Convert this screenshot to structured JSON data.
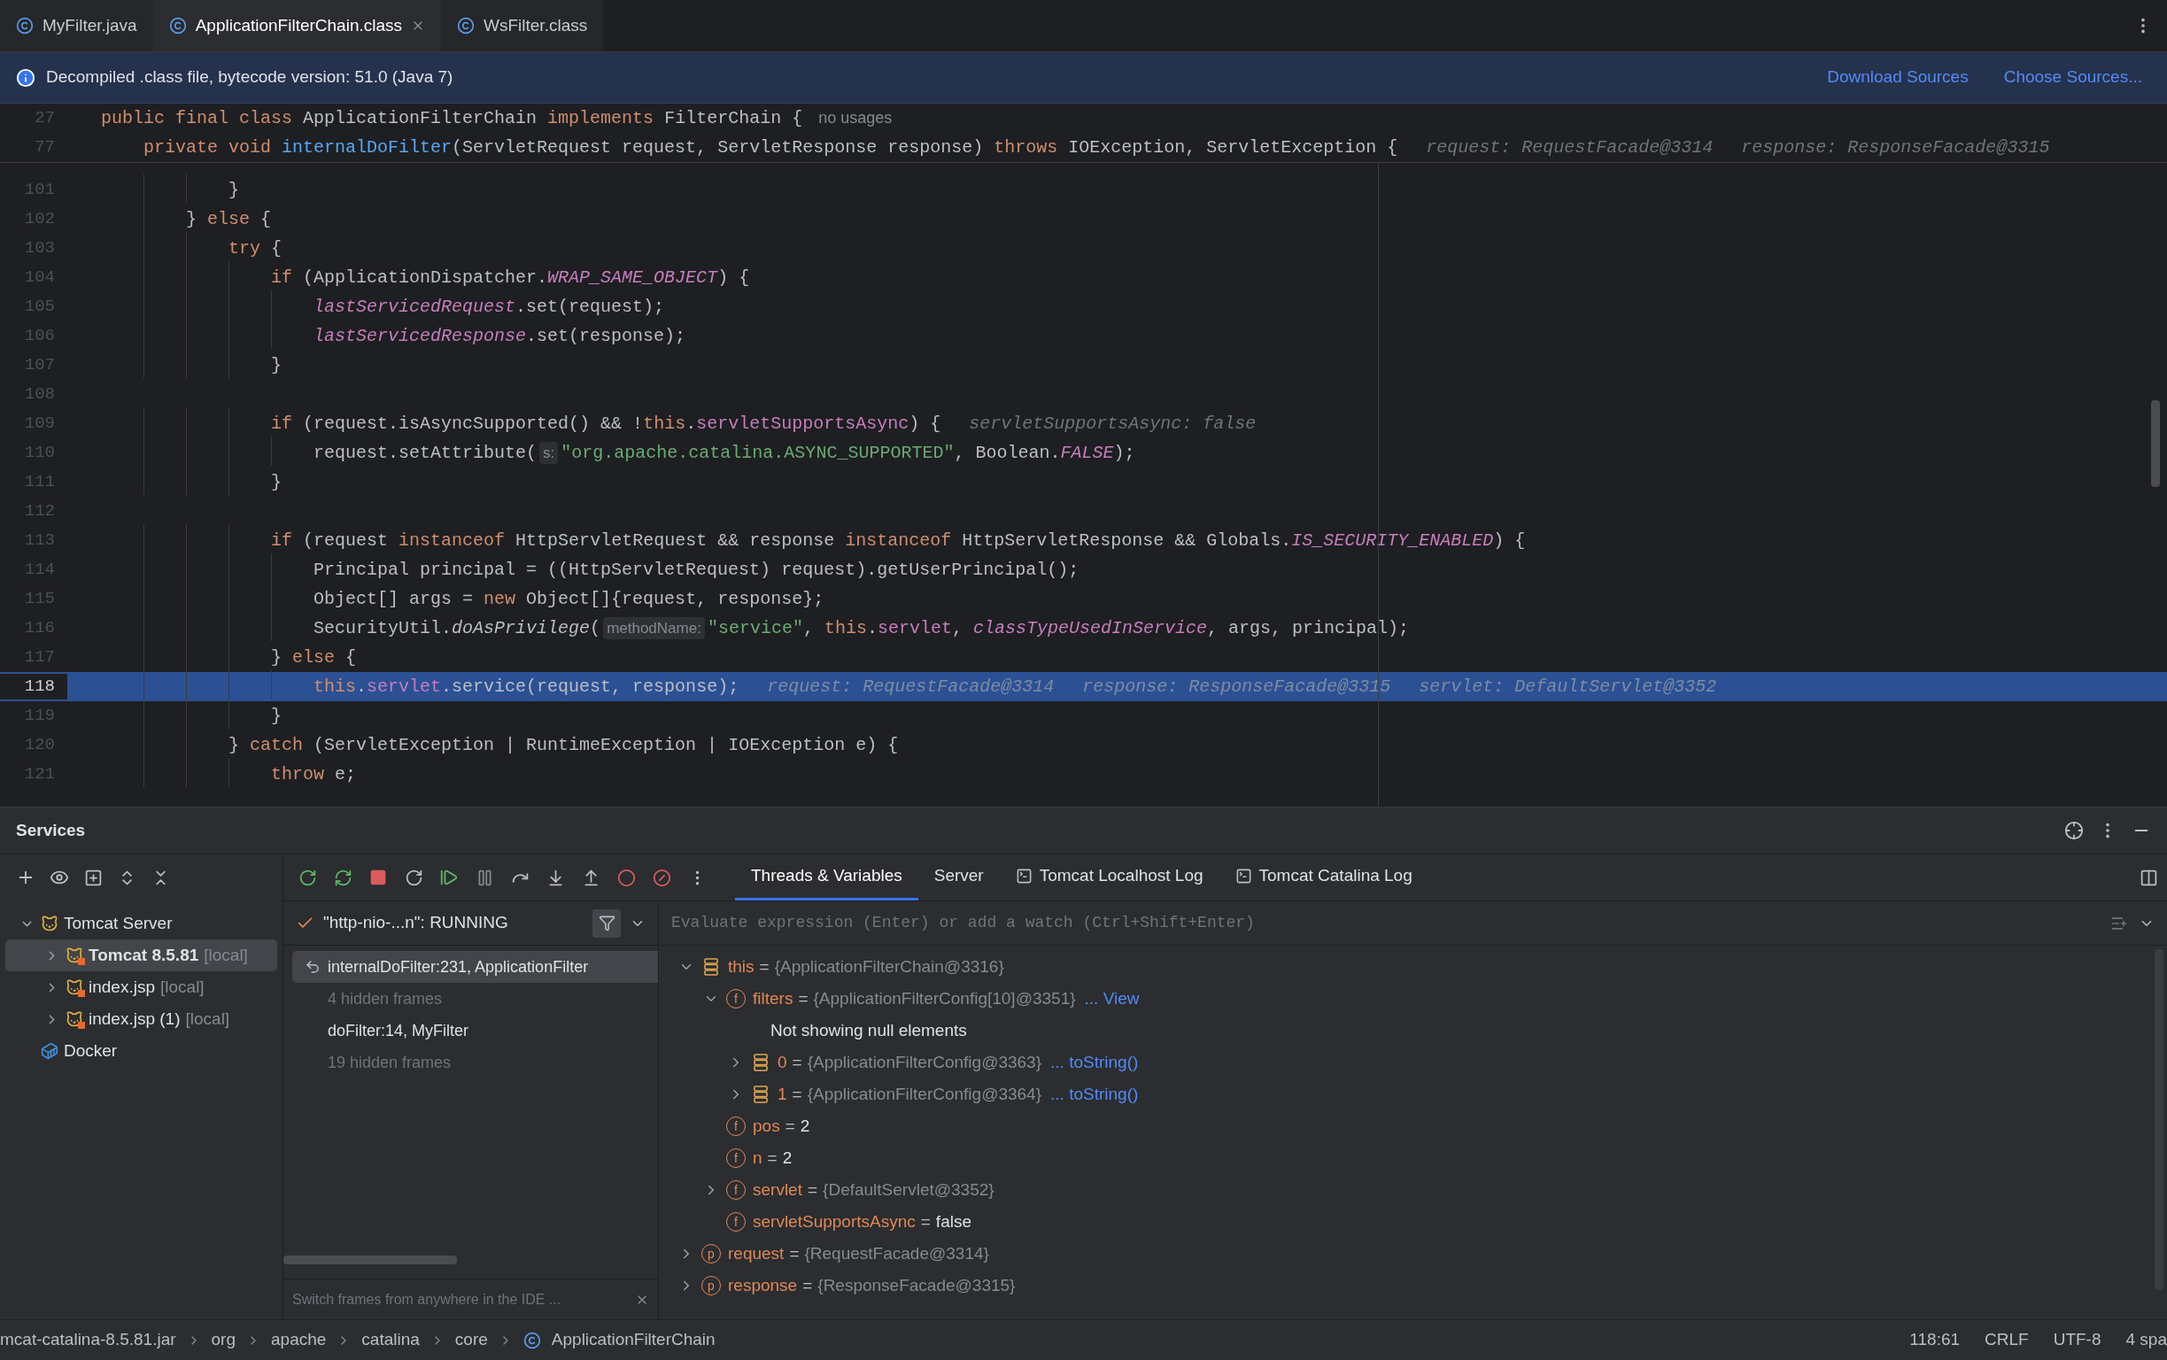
{
  "editor_tabs": [
    {
      "label": "MyFilter.java",
      "selected": false
    },
    {
      "label": "ApplicationFilterChain.class",
      "selected": true
    },
    {
      "label": "WsFilter.class",
      "selected": false
    }
  ],
  "banner": {
    "message": "Decompiled .class file, bytecode version: 51.0 (Java 7)",
    "links": [
      "Download Sources",
      "Choose Sources..."
    ]
  },
  "sticky_lines": [
    {
      "number": "27",
      "tokens": [
        {
          "kind": "keyword",
          "text": "public final class "
        },
        {
          "kind": "plain",
          "text": "ApplicationFilterChain "
        },
        {
          "kind": "keyword",
          "text": "implements "
        },
        {
          "kind": "plain",
          "text": "FilterChain {"
        },
        {
          "kind": "usage",
          "text": "no usages"
        }
      ]
    },
    {
      "number": "77",
      "tokens": [
        {
          "kind": "keyword",
          "text": "    private void "
        },
        {
          "kind": "method",
          "text": "internalDoFilter"
        },
        {
          "kind": "plain",
          "text": "(ServletRequest request, ServletResponse response) "
        },
        {
          "kind": "keyword",
          "text": "throws "
        },
        {
          "kind": "plain",
          "text": "IOException, ServletException {"
        },
        {
          "kind": "value",
          "text": "request: RequestFacade@3314"
        },
        {
          "kind": "value",
          "text": "response: ResponseFacade@3315"
        }
      ]
    }
  ],
  "code_lines": [
    {
      "number": "101",
      "current": false,
      "tokens": [
        {
          "kind": "plain",
          "text": "            }"
        }
      ]
    },
    {
      "number": "102",
      "current": false,
      "tokens": [
        {
          "kind": "plain",
          "text": "        } "
        },
        {
          "kind": "keyword",
          "text": "else"
        },
        {
          "kind": "plain",
          "text": " {"
        }
      ]
    },
    {
      "number": "103",
      "current": false,
      "tokens": [
        {
          "kind": "keyword",
          "text": "            try"
        },
        {
          "kind": "plain",
          "text": " {"
        }
      ]
    },
    {
      "number": "104",
      "current": false,
      "tokens": [
        {
          "kind": "keyword",
          "text": "                if"
        },
        {
          "kind": "plain",
          "text": " (ApplicationDispatcher."
        },
        {
          "kind": "static",
          "text": "WRAP_SAME_OBJECT"
        },
        {
          "kind": "plain",
          "text": ") {"
        }
      ]
    },
    {
      "number": "105",
      "current": false,
      "tokens": [
        {
          "kind": "static",
          "text": "                    lastServicedRequest"
        },
        {
          "kind": "plain",
          "text": ".set(request);"
        }
      ]
    },
    {
      "number": "106",
      "current": false,
      "tokens": [
        {
          "kind": "static",
          "text": "                    lastServicedResponse"
        },
        {
          "kind": "plain",
          "text": ".set(response);"
        }
      ]
    },
    {
      "number": "107",
      "current": false,
      "tokens": [
        {
          "kind": "plain",
          "text": "                }"
        }
      ]
    },
    {
      "number": "108",
      "current": false
    },
    {
      "number": "109",
      "current": false,
      "tokens": [
        {
          "kind": "keyword",
          "text": "                if"
        },
        {
          "kind": "plain",
          "text": " (request.isAsyncSupported() && !"
        },
        {
          "kind": "keyword",
          "text": "this"
        },
        {
          "kind": "plain",
          "text": "."
        },
        {
          "kind": "field",
          "text": "servletSupportsAsync"
        },
        {
          "kind": "plain",
          "text": ") {"
        },
        {
          "kind": "value",
          "text": "servletSupportsAsync: false"
        }
      ]
    },
    {
      "number": "110",
      "current": false,
      "tokens": [
        {
          "kind": "plain",
          "text": "                    request.setAttribute("
        },
        {
          "kind": "hint",
          "text": "s:"
        },
        {
          "kind": "string",
          "text": "\"org.apache.catalina.ASYNC_SUPPORTED\""
        },
        {
          "kind": "plain",
          "text": ", Boolean."
        },
        {
          "kind": "static",
          "text": "FALSE"
        },
        {
          "kind": "plain",
          "text": ");"
        }
      ]
    },
    {
      "number": "111",
      "current": false,
      "tokens": [
        {
          "kind": "plain",
          "text": "                }"
        }
      ]
    },
    {
      "number": "112",
      "current": false
    },
    {
      "number": "113",
      "current": false,
      "tokens": [
        {
          "kind": "keyword",
          "text": "                if"
        },
        {
          "kind": "plain",
          "text": " (request "
        },
        {
          "kind": "keyword",
          "text": "instanceof"
        },
        {
          "kind": "plain",
          "text": " HttpServletRequest && response "
        },
        {
          "kind": "keyword",
          "text": "instanceof"
        },
        {
          "kind": "plain",
          "text": " HttpServletResponse && Globals."
        },
        {
          "kind": "static",
          "text": "IS_SECURITY_ENABLED"
        },
        {
          "kind": "plain",
          "text": ") {"
        }
      ]
    },
    {
      "number": "114",
      "current": false,
      "tokens": [
        {
          "kind": "plain",
          "text": "                    Principal principal = ((HttpServletRequest) request).getUserPrincipal();"
        }
      ]
    },
    {
      "number": "115",
      "current": false,
      "tokens": [
        {
          "kind": "plain",
          "text": "                    Object[] args = "
        },
        {
          "kind": "keyword",
          "text": "new"
        },
        {
          "kind": "plain",
          "text": " Object[]{request, response};"
        }
      ]
    },
    {
      "number": "116",
      "current": false,
      "tokens": [
        {
          "kind": "plain",
          "text": "                    SecurityUtil."
        },
        {
          "kind": "static_call",
          "text": "doAsPrivilege"
        },
        {
          "kind": "plain",
          "text": "("
        },
        {
          "kind": "hint",
          "text": "methodName:"
        },
        {
          "kind": "string",
          "text": "\"service\""
        },
        {
          "kind": "plain",
          "text": ", "
        },
        {
          "kind": "keyword",
          "text": "this"
        },
        {
          "kind": "plain",
          "text": "."
        },
        {
          "kind": "field",
          "text": "servlet"
        },
        {
          "kind": "plain",
          "text": ", "
        },
        {
          "kind": "static",
          "text": "classTypeUsedInService"
        },
        {
          "kind": "plain",
          "text": ", args, principal);"
        }
      ]
    },
    {
      "number": "117",
      "current": false,
      "tokens": [
        {
          "kind": "plain",
          "text": "                } "
        },
        {
          "kind": "keyword",
          "text": "else"
        },
        {
          "kind": "plain",
          "text": " {"
        }
      ]
    },
    {
      "number": "118",
      "current": true,
      "tokens": [
        {
          "kind": "keyword",
          "text": "                    this"
        },
        {
          "kind": "plain",
          "text": "."
        },
        {
          "kind": "field",
          "text": "servlet"
        },
        {
          "kind": "plain",
          "text": ".service(request, response);"
        },
        {
          "kind": "value",
          "text": "request: RequestFacade@3314"
        },
        {
          "kind": "value",
          "text": "response: ResponseFacade@3315"
        },
        {
          "kind": "value",
          "text": "servlet: DefaultServlet@3352"
        }
      ]
    },
    {
      "number": "119",
      "current": false,
      "tokens": [
        {
          "kind": "plain",
          "text": "                }"
        }
      ]
    },
    {
      "number": "120",
      "current": false,
      "tokens": [
        {
          "kind": "plain",
          "text": "            } "
        },
        {
          "kind": "keyword",
          "text": "catch"
        },
        {
          "kind": "plain",
          "text": " (ServletException | RuntimeException | IOException e) {"
        }
      ]
    },
    {
      "number": "121",
      "current": false,
      "tokens": [
        {
          "kind": "keyword",
          "text": "                throw"
        },
        {
          "kind": "plain",
          "text": " e;"
        }
      ]
    }
  ],
  "services": {
    "title": "Services",
    "tree": [
      {
        "label": "Tomcat Server",
        "kind": "group",
        "expanded": true,
        "selected": false,
        "children": [
          {
            "label": "Tomcat 8.5.81",
            "suffix": "[local]",
            "kind": "server",
            "expanded": false,
            "selected": true
          },
          {
            "label": "index.jsp",
            "suffix": "[local]",
            "kind": "server",
            "expanded": false,
            "selected": false
          },
          {
            "label": "index.jsp (1)",
            "suffix": "[local]",
            "kind": "server",
            "expanded": false,
            "selected": false
          }
        ]
      },
      {
        "label": "Docker",
        "kind": "docker",
        "selected": false
      }
    ],
    "debug_tabs": [
      {
        "label": "Threads & Variables",
        "kind": "plain",
        "selected": true
      },
      {
        "label": "Server",
        "kind": "plain",
        "selected": false
      },
      {
        "label": "Tomcat Localhost Log",
        "kind": "console",
        "selected": false
      },
      {
        "label": "Tomcat Catalina Log",
        "kind": "console",
        "selected": false
      }
    ],
    "thread": {
      "label": "\"http-nio-...n\": RUNNING"
    },
    "frames": [
      {
        "label": "internalDoFilter:231, ApplicationFilter",
        "kind": "frame",
        "selected": true
      },
      {
        "label": "4 hidden frames",
        "kind": "hidden",
        "selected": false
      },
      {
        "label": "doFilter:14, MyFilter",
        "kind": "frame",
        "selected": false
      },
      {
        "label": "19 hidden frames",
        "kind": "hidden",
        "selected": false
      }
    ],
    "frames_tip": "Switch frames from anywhere in the IDE ...",
    "evaluate": {
      "placeholder": "Evaluate expression (Enter) or add a watch (Ctrl+Shift+Enter)"
    },
    "variables": [
      {
        "name": "this",
        "sep": "=",
        "value": "{ApplicationFilterChain@3316}",
        "kind": "array",
        "expanded": true,
        "children": [
          {
            "name": "filters",
            "sep": "=",
            "value": "{ApplicationFilterConfig[10]@3351}",
            "link": "... View",
            "kind": "field",
            "badge": "f",
            "expanded": true,
            "children": [
              {
                "kind": "note",
                "text": "Not showing null elements"
              },
              {
                "name": "0",
                "sep": "=",
                "value": "{ApplicationFilterConfig@3363}",
                "link": "... toString()",
                "kind": "array",
                "expanded": false
              },
              {
                "name": "1",
                "sep": "=",
                "value": "{ApplicationFilterConfig@3364}",
                "link": "... toString()",
                "kind": "array",
                "expanded": false
              }
            ]
          },
          {
            "name": "pos",
            "sep": "=",
            "value": "2",
            "kind": "field",
            "badge": "f"
          },
          {
            "name": "n",
            "sep": "=",
            "value": "2",
            "kind": "field",
            "badge": "f"
          },
          {
            "name": "servlet",
            "sep": "=",
            "value": "{DefaultServlet@3352}",
            "kind": "field",
            "badge": "f",
            "expanded": false
          },
          {
            "name": "servletSupportsAsync",
            "sep": "=",
            "value": "false",
            "kind": "field",
            "badge": "f"
          }
        ]
      },
      {
        "name": "request",
        "sep": "=",
        "value": "{RequestFacade@3314}",
        "kind": "field",
        "badge": "p",
        "expanded": false
      },
      {
        "name": "response",
        "sep": "=",
        "value": "{ResponseFacade@3315}",
        "kind": "field",
        "badge": "p",
        "expanded": false
      }
    ]
  },
  "status_bar": {
    "breadcrumbs": [
      {
        "label": "mcat-catalina-8.5.81.jar"
      },
      {
        "label": "org"
      },
      {
        "label": "apache"
      },
      {
        "label": "catalina"
      },
      {
        "label": "core"
      },
      {
        "label": "ApplicationFilterChain",
        "kind": "class"
      }
    ],
    "items": [
      "118:61",
      "CRLF",
      "UTF-8",
      "4 spa"
    ]
  }
}
